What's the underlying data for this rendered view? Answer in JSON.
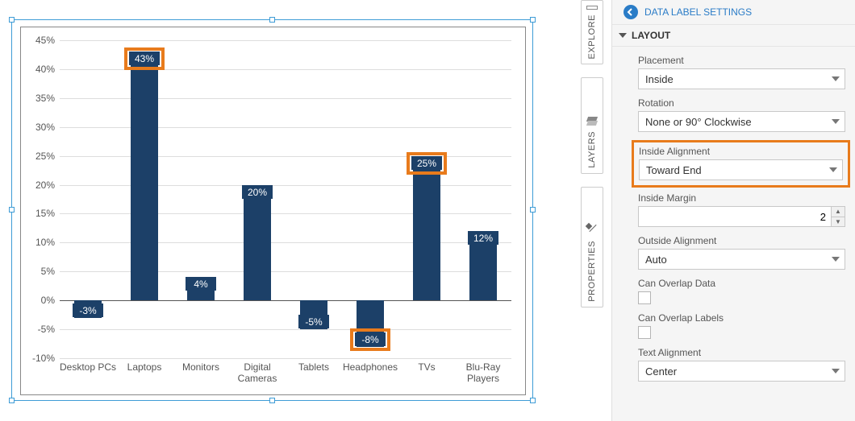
{
  "chart_data": {
    "type": "bar",
    "categories": [
      "Desktop PCs",
      "Laptops",
      "Monitors",
      "Digital Cameras",
      "Tablets",
      "Headphones",
      "TVs",
      "Blu-Ray Players"
    ],
    "values": [
      -3,
      43,
      4,
      20,
      -5,
      -8,
      25,
      12
    ],
    "value_labels": [
      "-3%",
      "43%",
      "4%",
      "20%",
      "-5%",
      "-8%",
      "25%",
      "12%"
    ],
    "ylim": [
      -10,
      45
    ],
    "yticks": [
      -10,
      -5,
      0,
      5,
      10,
      15,
      20,
      25,
      30,
      35,
      40,
      45
    ],
    "ytick_labels": [
      "-10%",
      "-5%",
      "0%",
      "5%",
      "10%",
      "15%",
      "20%",
      "25%",
      "30%",
      "35%",
      "40%",
      "45%"
    ],
    "bar_color": "#1c4068",
    "highlighted_indices": [
      1,
      5,
      6
    ]
  },
  "rails": {
    "explore": "EXPLORE",
    "layers": "LAYERS",
    "properties": "PROPERTIES"
  },
  "panel": {
    "header": "DATA LABEL SETTINGS",
    "section": "LAYOUT",
    "placement": {
      "label": "Placement",
      "value": "Inside"
    },
    "rotation": {
      "label": "Rotation",
      "value": "None or 90° Clockwise"
    },
    "inside_alignment": {
      "label": "Inside Alignment",
      "value": "Toward End"
    },
    "inside_margin": {
      "label": "Inside Margin",
      "value": "2"
    },
    "outside_alignment": {
      "label": "Outside Alignment",
      "value": "Auto"
    },
    "can_overlap_data": {
      "label": "Can Overlap Data",
      "checked": false
    },
    "can_overlap_labels": {
      "label": "Can Overlap Labels",
      "checked": false
    },
    "text_alignment": {
      "label": "Text Alignment",
      "value": "Center"
    }
  }
}
